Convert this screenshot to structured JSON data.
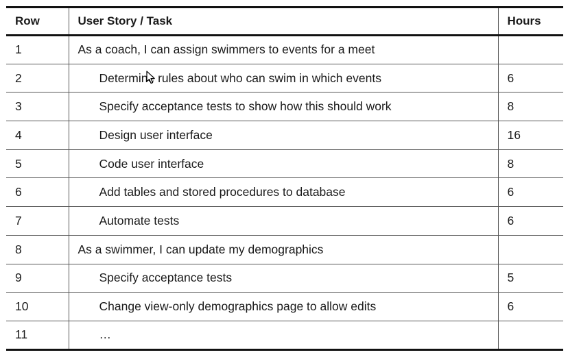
{
  "table": {
    "headers": {
      "row": "Row",
      "task": "User Story / Task",
      "hours": "Hours"
    },
    "rows": [
      {
        "row": "1",
        "task": "As a coach, I can assign swimmers to events for a meet",
        "hours": "",
        "indent": false
      },
      {
        "row": "2",
        "task": "Determine rules about who can swim in which events",
        "hours": "6",
        "indent": true
      },
      {
        "row": "3",
        "task": "Specify acceptance tests to show how this should work",
        "hours": "8",
        "indent": true
      },
      {
        "row": "4",
        "task": "Design user interface",
        "hours": "16",
        "indent": true
      },
      {
        "row": "5",
        "task": "Code user interface",
        "hours": "8",
        "indent": true
      },
      {
        "row": "6",
        "task": "Add tables and stored procedures to database",
        "hours": "6",
        "indent": true
      },
      {
        "row": "7",
        "task": "Automate tests",
        "hours": "6",
        "indent": true
      },
      {
        "row": "8",
        "task": "As a swimmer, I can update my demographics",
        "hours": "",
        "indent": false
      },
      {
        "row": "9",
        "task": "Specify acceptance tests",
        "hours": "5",
        "indent": true
      },
      {
        "row": "10",
        "task": "Change view-only demographics page to allow edits",
        "hours": "6",
        "indent": true
      },
      {
        "row": "11",
        "task": "…",
        "hours": "",
        "indent": true
      }
    ]
  },
  "cursor": {
    "icon": "mouse-pointer-icon"
  }
}
